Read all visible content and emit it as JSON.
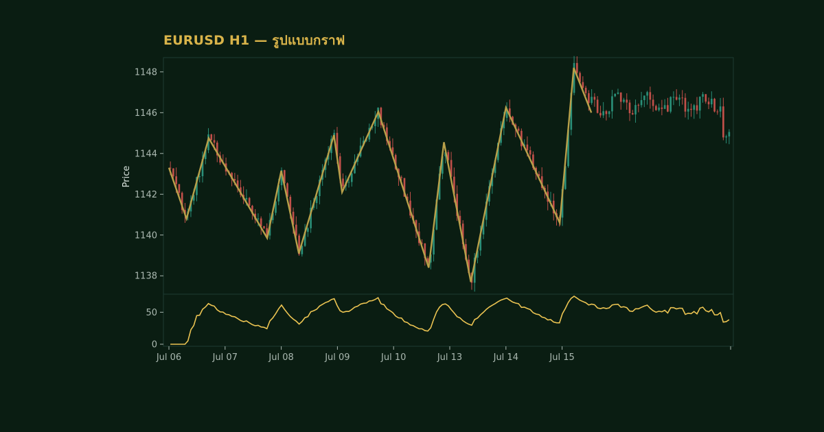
{
  "colors": {
    "background": "#0a1d12",
    "panel_border": "#1e3a33",
    "up": "#2a8f78",
    "down": "#c2504a",
    "zigzag": "#b8a04a",
    "indicator": "#ecc452",
    "title": "#d9b44a",
    "tick_text": "#aab8b0",
    "axis_title": "#d8e2dc"
  },
  "chart_data": [
    {
      "type": "candlestick",
      "title": "EURUSD H1 — รูปแบบกราฟ",
      "ylabel": "Price",
      "ylim": [
        1137.1,
        1148.7
      ],
      "yticks": [
        1138,
        1140,
        1142,
        1144,
        1146,
        1148
      ],
      "x_range": [
        0,
        240
      ],
      "date_ticks": [
        {
          "label": "Jul 06",
          "x": 0
        },
        {
          "label": "Jul 07",
          "x": 24
        },
        {
          "label": "Jul 08",
          "x": 48
        },
        {
          "label": "Jul 09",
          "x": 72
        },
        {
          "label": "Jul 10",
          "x": 96
        },
        {
          "label": "Jul 13",
          "x": 120
        },
        {
          "label": "Jul 14",
          "x": 144
        },
        {
          "label": "Jul 15",
          "x": 168
        }
      ],
      "candle_count": 192,
      "zigzag": [
        {
          "x": 0,
          "y": 1143.3
        },
        {
          "x": 7.5,
          "y": 1140.8
        },
        {
          "x": 17,
          "y": 1144.75
        },
        {
          "x": 42,
          "y": 1139.85
        },
        {
          "x": 48,
          "y": 1143.15
        },
        {
          "x": 55.5,
          "y": 1139.1
        },
        {
          "x": 70.5,
          "y": 1144.9
        },
        {
          "x": 74,
          "y": 1142.1
        },
        {
          "x": 89.5,
          "y": 1146.05
        },
        {
          "x": 111,
          "y": 1138.4
        },
        {
          "x": 117.5,
          "y": 1144.55
        },
        {
          "x": 129,
          "y": 1137.7
        },
        {
          "x": 144,
          "y": 1146.25
        },
        {
          "x": 167,
          "y": 1140.6
        },
        {
          "x": 173,
          "y": 1148.2
        },
        {
          "x": 180.5,
          "y": 1146.0
        }
      ]
    },
    {
      "type": "line",
      "ylim": [
        0,
        75
      ],
      "yticks": [
        0,
        50
      ]
    }
  ]
}
